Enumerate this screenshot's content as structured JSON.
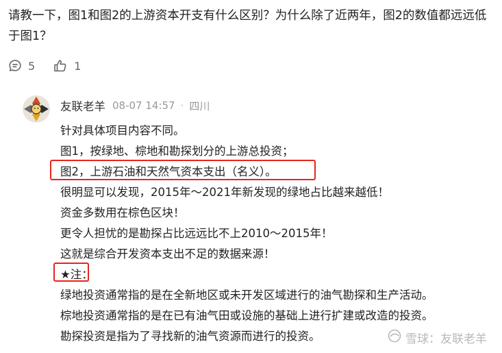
{
  "question": {
    "text": "请教一下，图1和图2的上游资本开支有什么区别？为什么除了近两年，图2的数值都远远低于图1？"
  },
  "actions": {
    "comment_count": "5",
    "like_count": "1",
    "comment_icon": "comment-icon",
    "like_icon": "thumbs-up-icon"
  },
  "reply": {
    "author": "友联老羊",
    "time": "08-07 14:57",
    "separator": "·",
    "location": "四川",
    "lines": [
      "针对具体项目内容不同。",
      "图1，按绿地、棕地和勘探划分的上游总投资；",
      "图2，上游石油和天然气资本支出（名义）。",
      "很明显可以发现，2015年～2021年新发现的绿地占比越来越低！",
      "资金多数用在棕色区块！",
      "更令人担忧的是勘探占比远远比不上2010～2015年！",
      "这就是综合开发资本支出不足的数据来源！",
      "★注：",
      "绿地投资通常指的是在全新地区或未开发区域进行的油气勘探和生产活动。",
      "棕地投资通常指的是在已有油气田或设施的基础上进行扩建或改造的投资。",
      "勘探投资是指为了寻找新的油气资源而进行的投资。"
    ]
  },
  "watermark": {
    "text": "雪球：友联老羊"
  },
  "colors": {
    "highlight": "#e8231d",
    "text": "#222222",
    "muted": "#999999"
  }
}
